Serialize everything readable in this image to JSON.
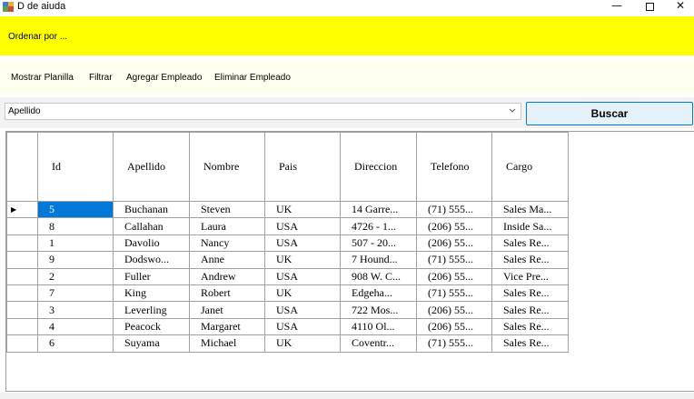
{
  "window": {
    "title": "D de aiuda",
    "minimize_glyph": "—",
    "close_glyph": "✕"
  },
  "header": {
    "label": "Ordenar por ..."
  },
  "menu": {
    "items": [
      {
        "label": "Mostrar  Planilla"
      },
      {
        "label": "Filtrar"
      },
      {
        "label": "Agregar Empleado"
      },
      {
        "label": "Eliminar Empleado"
      }
    ]
  },
  "search": {
    "selected_value": "Apellido",
    "button_label": "Buscar"
  },
  "grid": {
    "columns": [
      "Id",
      "Apellido",
      "Nombre",
      "Pais",
      "Direccion",
      "Telefono",
      "Cargo"
    ],
    "current_row_marker": "▶",
    "rows": [
      [
        "5",
        "Buchanan",
        "Steven",
        "UK",
        "14 Garre...",
        "(71) 555...",
        "Sales Ma..."
      ],
      [
        "8",
        "Callahan",
        "Laura",
        "USA",
        "4726 - 1...",
        "(206) 55...",
        "Inside Sa..."
      ],
      [
        "1",
        "Davolio",
        "Nancy",
        "USA",
        "507 - 20...",
        "(206) 55...",
        "Sales Re..."
      ],
      [
        "9",
        "Dodswo...",
        "Anne",
        "UK",
        "7 Hound...",
        "(71) 555...",
        "Sales Re..."
      ],
      [
        "2",
        "Fuller",
        "Andrew",
        "USA",
        "908 W. C...",
        "(206) 55...",
        "Vice Pre..."
      ],
      [
        "7",
        "King",
        "Robert",
        "UK",
        "Edgeha...",
        "(71) 555...",
        "Sales Re..."
      ],
      [
        "3",
        "Leverling",
        "Janet",
        "USA",
        "722 Mos...",
        "(206) 55...",
        "Sales Re..."
      ],
      [
        "4",
        "Peacock",
        "Margaret",
        "USA",
        "4110 Ol...",
        "(206) 55...",
        "Sales Re..."
      ],
      [
        "6",
        "Suyama",
        "Michael",
        "UK",
        "Coventr...",
        "(71) 555...",
        "Sales Re..."
      ]
    ]
  },
  "colors": {
    "header_bg": "#ffff00",
    "menu_bg": "#fffff0",
    "selection": "#0078d7",
    "button_bg": "#e5f1fb"
  }
}
